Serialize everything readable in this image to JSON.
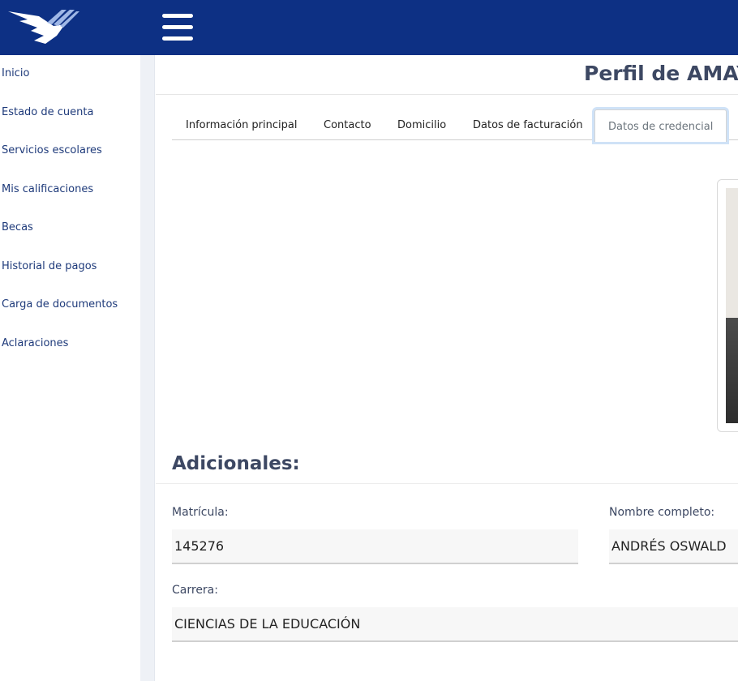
{
  "colors": {
    "header_bg": "#0d3084",
    "link": "#1e3a7a",
    "title": "#3d4863",
    "active_tab_ring": "#cfe2f7"
  },
  "header": {
    "logo": "eagle-logo-icon",
    "menu_icon": "hamburger-icon"
  },
  "sidebar": {
    "items": [
      {
        "label": "Inicio"
      },
      {
        "label": "Estado de cuenta"
      },
      {
        "label": "Servicios escolares"
      },
      {
        "label": "Mis calificaciones"
      },
      {
        "label": "Becas"
      },
      {
        "label": "Historial de pagos"
      },
      {
        "label": "Carga de documentos"
      },
      {
        "label": "Aclaraciones"
      }
    ]
  },
  "main": {
    "title": "Perfil de AMAYA",
    "tabs": [
      {
        "label": "Información principal"
      },
      {
        "label": "Contacto"
      },
      {
        "label": "Domicilio"
      },
      {
        "label": "Datos de facturación"
      },
      {
        "label": "Datos de credencial",
        "active": true
      }
    ],
    "section_title": "Adicionales:",
    "fields": {
      "matricula": {
        "label": "Matrícula:",
        "value": "145276"
      },
      "nombre": {
        "label": "Nombre completo:",
        "value": "ANDRÉS OSWALD"
      },
      "carrera": {
        "label": "Carrera:",
        "value": "CIENCIAS DE LA EDUCACIÓN"
      }
    }
  }
}
